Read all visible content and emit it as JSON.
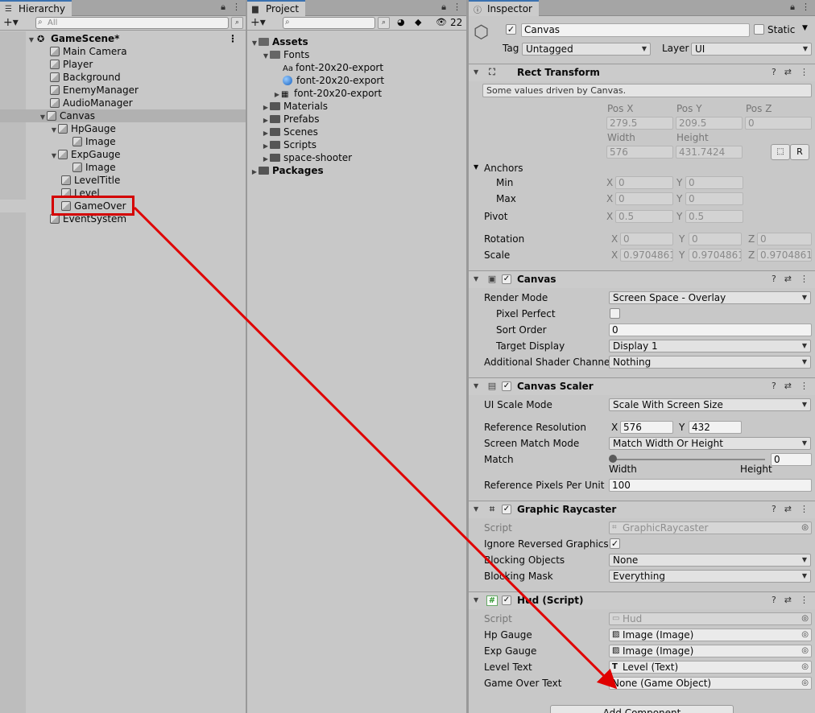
{
  "hierarchy": {
    "tab": "Hierarchy",
    "search_placeholder": "All",
    "scene": "GameScene*",
    "items": [
      "Main Camera",
      "Player",
      "Background",
      "EnemyManager",
      "AudioManager",
      "Canvas",
      "HpGauge",
      "Image",
      "ExpGauge",
      "Image",
      "LevelTitle",
      "Level",
      "GameOver",
      "EventSystem"
    ]
  },
  "project": {
    "tab": "Project",
    "badge": "22",
    "items": [
      "Assets",
      "Fonts",
      "font-20x20-export",
      "font-20x20-export",
      "font-20x20-export",
      "Materials",
      "Prefabs",
      "Scenes",
      "Scripts",
      "space-shooter",
      "Packages"
    ]
  },
  "inspector": {
    "tab": "Inspector",
    "object_name": "Canvas",
    "static_label": "Static",
    "tag_label": "Tag",
    "tag_value": "Untagged",
    "layer_label": "Layer",
    "layer_value": "UI",
    "rect": {
      "title": "Rect Transform",
      "note": "Some values driven by Canvas.",
      "posx_label": "Pos X",
      "posy_label": "Pos Y",
      "posz_label": "Pos Z",
      "posx": "279.5",
      "posy": "209.5",
      "posz": "0",
      "width_label": "Width",
      "height_label": "Height",
      "width": "576",
      "height": "431.7424",
      "r_btn": "R",
      "anchors_label": "Anchors",
      "min_label": "Min",
      "max_label": "Max",
      "min_x": "0",
      "min_y": "0",
      "max_x": "0",
      "max_y": "0",
      "pivot_label": "Pivot",
      "pivot_x": "0.5",
      "pivot_y": "0.5",
      "rotation_label": "Rotation",
      "rot_x": "0",
      "rot_y": "0",
      "rot_z": "0",
      "scale_label": "Scale",
      "scale_x": "0.9704861",
      "scale_y": "0.9704861",
      "scale_z": "0.9704861",
      "x": "X",
      "y": "Y",
      "z": "Z"
    },
    "canvas": {
      "title": "Canvas",
      "render_mode_label": "Render Mode",
      "render_mode": "Screen Space - Overlay",
      "pixel_perfect_label": "Pixel Perfect",
      "sort_order_label": "Sort Order",
      "sort_order": "0",
      "target_display_label": "Target Display",
      "target_display": "Display 1",
      "shader_channels_label": "Additional Shader Channels",
      "shader_channels": "Nothing"
    },
    "scaler": {
      "title": "Canvas Scaler",
      "mode_label": "UI Scale Mode",
      "mode": "Scale With Screen Size",
      "ref_res_label": "Reference Resolution",
      "ref_x": "576",
      "ref_y": "432",
      "match_mode_label": "Screen Match Mode",
      "match_mode": "Match Width Or Height",
      "match_label": "Match",
      "match_value": "0",
      "match_fraction": 0,
      "width_label": "Width",
      "height_label": "Height",
      "ppu_label": "Reference Pixels Per Unit",
      "ppu": "100"
    },
    "raycaster": {
      "title": "Graphic Raycaster",
      "script_label": "Script",
      "script": "GraphicRaycaster",
      "ignore_label": "Ignore Reversed Graphics",
      "blocking_label": "Blocking Objects",
      "blocking": "None",
      "mask_label": "Blocking Mask",
      "mask": "Everything"
    },
    "hud": {
      "title": "Hud (Script)",
      "script_label": "Script",
      "script": "Hud",
      "hp_label": "Hp Gauge",
      "hp": "Image (Image)",
      "exp_label": "Exp Gauge",
      "exp": "Image (Image)",
      "level_label": "Level Text",
      "level": "Level (Text)",
      "gameover_label": "Game Over Text",
      "gameover": "None (Game Object)"
    },
    "add_component": "Add Component"
  },
  "colors": {
    "highlight": "#d40000",
    "arrow": "#e00000",
    "selection": "#b1b1b1",
    "tab_accent": "#3a72b0"
  }
}
